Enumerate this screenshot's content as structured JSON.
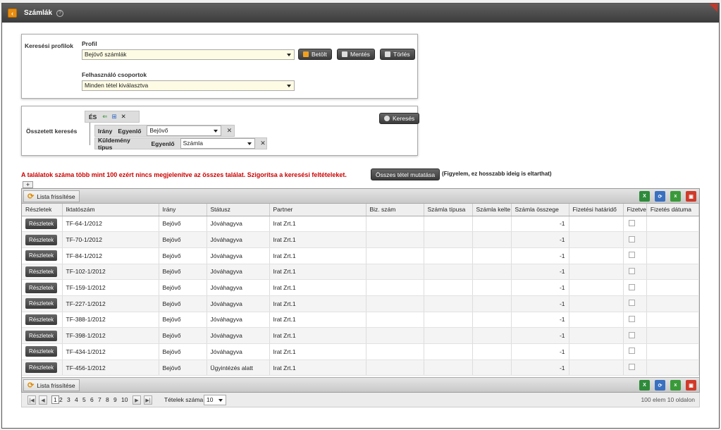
{
  "window": {
    "title": "Számlák"
  },
  "search": {
    "profiles_label": "Keresési profilok",
    "profil_label": "Profil",
    "profil_value": "Bejövő számlák",
    "load_label": "Betölt",
    "save_label": "Mentés",
    "delete_label": "Törlés",
    "groups_label": "Felhasználó csoportok",
    "groups_value": "Minden tétel kiválasztva",
    "complex_label": "Összetett keresés",
    "and_label": "ÉS",
    "cond1_field": "Irány",
    "cond1_op": "Egyenlő",
    "cond1_value": "Bejövő",
    "cond2_field": "Küldemény típus",
    "cond2_op": "Egyenlő",
    "cond2_value": "Számla",
    "search_button": "Keresés"
  },
  "warning": {
    "text": "A találatok száma több mint 100 ezért nincs megjelenítve az összes találat. Szigorítsa a keresési feltételeket.",
    "show_all": "Összes tétel mutatása",
    "note": "(Figyelem, ez hosszabb ideig is eltarthat)"
  },
  "grid": {
    "refresh_label": "Lista frissítése",
    "columns": [
      "Részletek",
      "Iktatószám",
      "Irány",
      "Státusz",
      "Partner",
      "Biz. szám",
      "Számla típusa",
      "Számla kelte",
      "Számla összege",
      "Fizetési határidő",
      "Fizetve",
      "Fizetés dátuma"
    ],
    "detail_label": "Részletek",
    "rows": [
      {
        "iktato": "TF-64-1/2012",
        "irany": "Bejövő",
        "statusz": "Jóváhagyva",
        "partner": "Irat Zrt.1",
        "osszeg": "-1"
      },
      {
        "iktato": "TF-70-1/2012",
        "irany": "Bejövő",
        "statusz": "Jóváhagyva",
        "partner": "Irat Zrt.1",
        "osszeg": "-1"
      },
      {
        "iktato": "TF-84-1/2012",
        "irany": "Bejövő",
        "statusz": "Jóváhagyva",
        "partner": "Irat Zrt.1",
        "osszeg": "-1"
      },
      {
        "iktato": "TF-102-1/2012",
        "irany": "Bejövő",
        "statusz": "Jóváhagyva",
        "partner": "Irat Zrt.1",
        "osszeg": "-1"
      },
      {
        "iktato": "TF-159-1/2012",
        "irany": "Bejövő",
        "statusz": "Jóváhagyva",
        "partner": "Irat Zrt.1",
        "osszeg": "-1"
      },
      {
        "iktato": "TF-227-1/2012",
        "irany": "Bejövő",
        "statusz": "Jóváhagyva",
        "partner": "Irat Zrt.1",
        "osszeg": "-1"
      },
      {
        "iktato": "TF-388-1/2012",
        "irany": "Bejövő",
        "statusz": "Jóváhagyva",
        "partner": "Irat Zrt.1",
        "osszeg": "-1"
      },
      {
        "iktato": "TF-398-1/2012",
        "irany": "Bejövő",
        "statusz": "Jóváhagyva",
        "partner": "Irat Zrt.1",
        "osszeg": "-1"
      },
      {
        "iktato": "TF-434-1/2012",
        "irany": "Bejövő",
        "statusz": "Jóváhagyva",
        "partner": "Irat Zrt.1",
        "osszeg": "-1"
      },
      {
        "iktato": "TF-456-1/2012",
        "irany": "Bejövő",
        "statusz": "Ügyintézés alatt",
        "partner": "Irat Zrt.1",
        "osszeg": "-1"
      }
    ],
    "export_icons": [
      "excel-export-icon",
      "refresh-export-icon",
      "csv-export-icon",
      "pdf-export-icon"
    ]
  },
  "pager": {
    "pages": [
      "1",
      "2",
      "3",
      "4",
      "5",
      "6",
      "7",
      "8",
      "9",
      "10"
    ],
    "current": "1",
    "items_label": "Tételek száma:",
    "items_value": "10",
    "summary": "100 elem 10 oldalon"
  },
  "colors": {
    "warning": "#cc0000",
    "accent": "#e88c10",
    "button_dark": "#3b3b3b"
  }
}
